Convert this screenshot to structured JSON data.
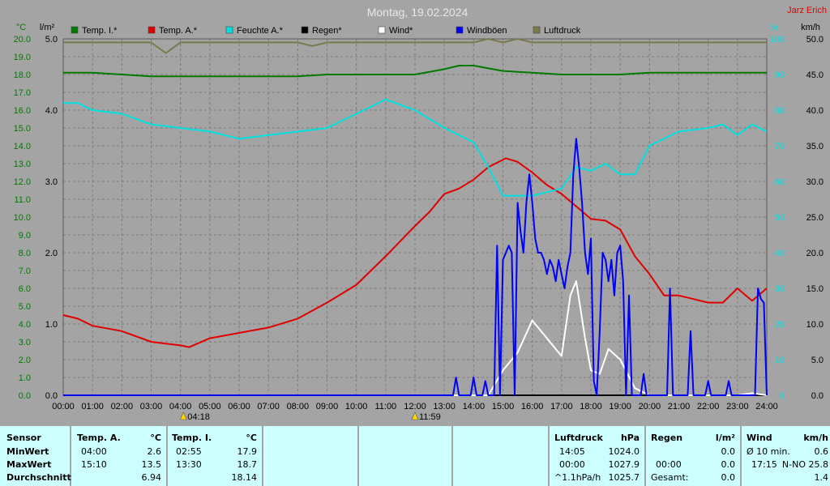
{
  "header": {
    "title": "Montag, 19.02.2024",
    "station": "Jarz Erich"
  },
  "legend": [
    {
      "label": "Temp. I.*",
      "color": "#007a00"
    },
    {
      "label": "Temp. A.*",
      "color": "#e00000"
    },
    {
      "label": "Feuchte A.*",
      "color": "#00e0e0"
    },
    {
      "label": "Regen*",
      "color": "#000000"
    },
    {
      "label": "Wind*",
      "color": "#ffffff"
    },
    {
      "label": "Windböen",
      "color": "#0000ff"
    },
    {
      "label": "Luftdruck",
      "color": "#7a7a4a"
    }
  ],
  "chart_data": {
    "type": "line",
    "axes": {
      "temp_unit": "°C",
      "temp_range": [
        0,
        20
      ],
      "temp_ticks": [
        "0.0",
        "1.0",
        "2.0",
        "3.0",
        "4.0",
        "5.0",
        "6.0",
        "7.0",
        "8.0",
        "9.0",
        "10.0",
        "11.0",
        "12.0",
        "13.0",
        "14.0",
        "15.0",
        "16.0",
        "17.0",
        "18.0",
        "19.0",
        "20.0"
      ],
      "rain_unit": "l/m²",
      "rain_range": [
        0,
        5
      ],
      "rain_ticks": [
        "0.0",
        "1.0",
        "2.0",
        "3.0",
        "4.0",
        "5.0"
      ],
      "hum_unit": "%",
      "hum_range": [
        0,
        100
      ],
      "hum_ticks": [
        "0",
        "10",
        "20",
        "30",
        "40",
        "50",
        "60",
        "70",
        "80",
        "90",
        "100"
      ],
      "wind_unit": "km/h",
      "wind_range": [
        0,
        50
      ],
      "wind_ticks": [
        "0.0",
        "5.0",
        "10.0",
        "15.0",
        "20.0",
        "25.0",
        "30.0",
        "35.0",
        "40.0",
        "45.0",
        "50.0"
      ],
      "time_ticks": [
        "00:00",
        "01:00",
        "02:00",
        "03:00",
        "04:00",
        "05:00",
        "06:00",
        "07:00",
        "08:00",
        "09:00",
        "10:00",
        "11:00",
        "12:00",
        "13:00",
        "14:00",
        "15:00",
        "16:00",
        "17:00",
        "18:00",
        "19:00",
        "20:00",
        "21:00",
        "22:00",
        "23:00",
        "24:00"
      ]
    },
    "markers": [
      {
        "label": "04:18",
        "hour": 4.1
      },
      {
        "label": "11:59",
        "hour": 12.0
      }
    ],
    "series": [
      {
        "name": "Temp. I.*",
        "axis": "temp",
        "color": "#007a00",
        "points": [
          [
            0,
            18.1
          ],
          [
            1,
            18.1
          ],
          [
            2,
            18.0
          ],
          [
            3,
            17.9
          ],
          [
            4,
            17.9
          ],
          [
            5,
            17.9
          ],
          [
            6,
            17.9
          ],
          [
            7,
            17.9
          ],
          [
            8,
            17.9
          ],
          [
            9,
            18.0
          ],
          [
            10,
            18.0
          ],
          [
            11,
            18.0
          ],
          [
            12,
            18.0
          ],
          [
            13,
            18.3
          ],
          [
            13.5,
            18.5
          ],
          [
            14,
            18.5
          ],
          [
            15,
            18.2
          ],
          [
            16,
            18.1
          ],
          [
            17,
            18.0
          ],
          [
            18,
            18.0
          ],
          [
            19,
            18.0
          ],
          [
            20,
            18.1
          ],
          [
            21,
            18.1
          ],
          [
            22,
            18.1
          ],
          [
            23,
            18.1
          ],
          [
            24,
            18.1
          ]
        ]
      },
      {
        "name": "Temp. A.*",
        "axis": "temp",
        "color": "#e00000",
        "points": [
          [
            0,
            4.5
          ],
          [
            0.5,
            4.3
          ],
          [
            1,
            3.9
          ],
          [
            2,
            3.6
          ],
          [
            3,
            3.0
          ],
          [
            3.5,
            2.9
          ],
          [
            4,
            2.8
          ],
          [
            4.3,
            2.7
          ],
          [
            5,
            3.2
          ],
          [
            6,
            3.5
          ],
          [
            7,
            3.8
          ],
          [
            8,
            4.3
          ],
          [
            9,
            5.2
          ],
          [
            10,
            6.2
          ],
          [
            11,
            7.8
          ],
          [
            12,
            9.5
          ],
          [
            12.5,
            10.3
          ],
          [
            13,
            11.3
          ],
          [
            13.5,
            11.6
          ],
          [
            14,
            12.1
          ],
          [
            14.5,
            12.8
          ],
          [
            15.1,
            13.3
          ],
          [
            15.5,
            13.1
          ],
          [
            16,
            12.5
          ],
          [
            16.5,
            11.8
          ],
          [
            17,
            11.3
          ],
          [
            17.5,
            10.6
          ],
          [
            18,
            9.9
          ],
          [
            18.5,
            9.8
          ],
          [
            19,
            9.3
          ],
          [
            19.5,
            7.8
          ],
          [
            20,
            6.8
          ],
          [
            20.5,
            5.6
          ],
          [
            21,
            5.6
          ],
          [
            21.5,
            5.4
          ],
          [
            22,
            5.2
          ],
          [
            22.5,
            5.2
          ],
          [
            23,
            6.0
          ],
          [
            23.5,
            5.3
          ],
          [
            24,
            6.0
          ]
        ]
      },
      {
        "name": "Feuchte A.*",
        "axis": "hum",
        "color": "#00e0e0",
        "points": [
          [
            0,
            82
          ],
          [
            0.5,
            82
          ],
          [
            1,
            80
          ],
          [
            2,
            79
          ],
          [
            3,
            76
          ],
          [
            4,
            75
          ],
          [
            5,
            74
          ],
          [
            6,
            72
          ],
          [
            7,
            73
          ],
          [
            8,
            74
          ],
          [
            9,
            75
          ],
          [
            10,
            79
          ],
          [
            11,
            83
          ],
          [
            12,
            80
          ],
          [
            13,
            75
          ],
          [
            14,
            71
          ],
          [
            14.5,
            64
          ],
          [
            15,
            56
          ],
          [
            15.5,
            56
          ],
          [
            16,
            56
          ],
          [
            16.5,
            57
          ],
          [
            17,
            58
          ],
          [
            17.5,
            64
          ],
          [
            18,
            63
          ],
          [
            18.5,
            65
          ],
          [
            19,
            62
          ],
          [
            19.5,
            62
          ],
          [
            20,
            70
          ],
          [
            21,
            74
          ],
          [
            22,
            75
          ],
          [
            22.5,
            76
          ],
          [
            23,
            73
          ],
          [
            23.5,
            76
          ],
          [
            24,
            74
          ]
        ]
      },
      {
        "name": "Regen*",
        "axis": "rain",
        "color": "#000000",
        "points": [
          [
            0,
            0
          ],
          [
            24,
            0
          ]
        ]
      },
      {
        "name": "Wind*",
        "axis": "wind",
        "color": "#ffffff",
        "points": [
          [
            0,
            0
          ],
          [
            14.5,
            0
          ],
          [
            15,
            3.5
          ],
          [
            15.5,
            6
          ],
          [
            16,
            10.5
          ],
          [
            16.3,
            9
          ],
          [
            16.6,
            7.5
          ],
          [
            17,
            5.5
          ],
          [
            17.3,
            14
          ],
          [
            17.5,
            16
          ],
          [
            17.8,
            8
          ],
          [
            18,
            3.5
          ],
          [
            18.3,
            3
          ],
          [
            18.6,
            6.5
          ],
          [
            19,
            5
          ],
          [
            19.5,
            1
          ],
          [
            20,
            0
          ],
          [
            23,
            0
          ],
          [
            23.5,
            0.3
          ],
          [
            24,
            0
          ]
        ]
      },
      {
        "name": "Windböen",
        "axis": "wind",
        "color": "#0000ff",
        "points": [
          [
            0,
            0
          ],
          [
            13.3,
            0
          ],
          [
            13.4,
            2.5
          ],
          [
            13.5,
            0
          ],
          [
            13.9,
            0
          ],
          [
            14,
            2.5
          ],
          [
            14.1,
            0
          ],
          [
            14.3,
            0
          ],
          [
            14.4,
            2
          ],
          [
            14.5,
            0
          ],
          [
            14.7,
            0
          ],
          [
            14.8,
            21
          ],
          [
            14.9,
            0
          ],
          [
            15.0,
            19
          ],
          [
            15.1,
            20
          ],
          [
            15.2,
            21
          ],
          [
            15.3,
            20
          ],
          [
            15.4,
            0
          ],
          [
            15.5,
            27
          ],
          [
            15.6,
            23
          ],
          [
            15.7,
            20
          ],
          [
            15.8,
            27
          ],
          [
            15.9,
            31
          ],
          [
            16.0,
            27
          ],
          [
            16.1,
            22
          ],
          [
            16.2,
            20
          ],
          [
            16.3,
            20
          ],
          [
            16.4,
            19
          ],
          [
            16.5,
            17
          ],
          [
            16.6,
            19
          ],
          [
            16.7,
            18
          ],
          [
            16.8,
            16
          ],
          [
            16.9,
            19
          ],
          [
            17.0,
            17
          ],
          [
            17.1,
            15
          ],
          [
            17.2,
            18
          ],
          [
            17.3,
            20
          ],
          [
            17.4,
            31
          ],
          [
            17.5,
            36
          ],
          [
            17.6,
            32
          ],
          [
            17.7,
            27
          ],
          [
            17.8,
            20
          ],
          [
            17.9,
            17
          ],
          [
            18.0,
            22
          ],
          [
            18.1,
            2
          ],
          [
            18.2,
            0
          ],
          [
            18.3,
            9
          ],
          [
            18.4,
            20
          ],
          [
            18.5,
            19
          ],
          [
            18.6,
            16
          ],
          [
            18.7,
            19
          ],
          [
            18.8,
            14
          ],
          [
            18.9,
            20
          ],
          [
            19.0,
            21
          ],
          [
            19.1,
            16
          ],
          [
            19.2,
            0
          ],
          [
            19.3,
            14
          ],
          [
            19.4,
            0
          ],
          [
            19.7,
            0
          ],
          [
            19.8,
            3
          ],
          [
            19.9,
            0
          ],
          [
            20.6,
            0
          ],
          [
            20.7,
            15
          ],
          [
            20.8,
            0
          ],
          [
            21.3,
            0
          ],
          [
            21.4,
            9
          ],
          [
            21.5,
            0
          ],
          [
            21.9,
            0
          ],
          [
            22.0,
            2
          ],
          [
            22.1,
            0
          ],
          [
            22.6,
            0
          ],
          [
            22.7,
            2
          ],
          [
            22.8,
            0
          ],
          [
            23.6,
            0
          ],
          [
            23.7,
            15
          ],
          [
            23.8,
            13.5
          ],
          [
            23.9,
            13
          ],
          [
            24.0,
            0
          ]
        ]
      },
      {
        "name": "Luftdruck",
        "axis": "hum",
        "color": "#7a7a4a",
        "points": [
          [
            0,
            99
          ],
          [
            3,
            99
          ],
          [
            3.5,
            96
          ],
          [
            4,
            99
          ],
          [
            8,
            99
          ],
          [
            8.5,
            98
          ],
          [
            9,
            99
          ],
          [
            14,
            99
          ],
          [
            14.5,
            100
          ],
          [
            15,
            99
          ],
          [
            15.5,
            100
          ],
          [
            16,
            99
          ],
          [
            24,
            99
          ]
        ]
      }
    ]
  },
  "stats": {
    "sensor": {
      "header": "Sensor",
      "rows": [
        "MinWert",
        "MaxWert",
        "Durchschnitt"
      ]
    },
    "temp_a": {
      "header": "Temp. A.",
      "unit": "°C",
      "rows": [
        [
          "04:00",
          "2.6"
        ],
        [
          "15:10",
          "13.5"
        ],
        [
          "",
          "6.94"
        ]
      ]
    },
    "temp_i": {
      "header": "Temp. I.",
      "unit": "°C",
      "rows": [
        [
          "02:55",
          "17.9"
        ],
        [
          "13:30",
          "18.7"
        ],
        [
          "",
          "18.14"
        ]
      ]
    },
    "luftdruck": {
      "header": "Luftdruck",
      "unit": "hPa",
      "rows": [
        [
          "14:05",
          "1024.0"
        ],
        [
          "00:00",
          "1027.9"
        ],
        [
          "^1.1hPa/h",
          "1025.7"
        ]
      ]
    },
    "regen": {
      "header": "Regen",
      "unit": "l/m²",
      "rows": [
        [
          "",
          "0.0"
        ],
        [
          "00:00",
          "0.0"
        ],
        [
          "Gesamt:",
          "0.0"
        ]
      ]
    },
    "wind": {
      "header": "Wind",
      "unit": "km/h",
      "rows": [
        [
          "Ø 10 min.",
          "0.6"
        ],
        [
          "17:15",
          "N-NO 25.8"
        ],
        [
          "",
          "1.4"
        ]
      ]
    }
  }
}
